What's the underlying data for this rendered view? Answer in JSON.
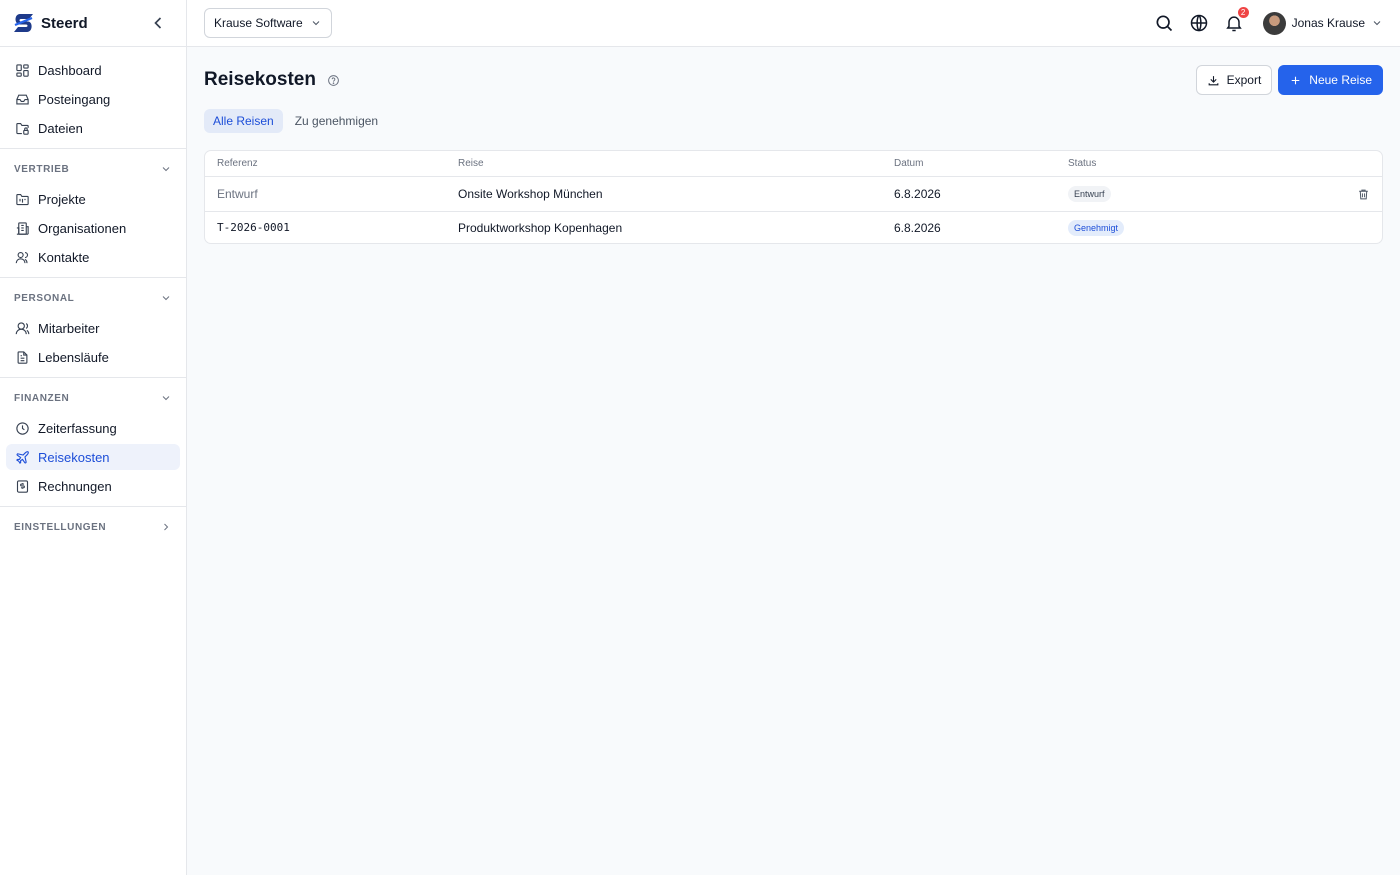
{
  "brand": {
    "name": "Steerd"
  },
  "sidebar": {
    "main_items": [
      {
        "label": "Dashboard",
        "icon": "dashboard-icon"
      },
      {
        "label": "Posteingang",
        "icon": "inbox-icon"
      },
      {
        "label": "Dateien",
        "icon": "folder-lock-icon"
      }
    ],
    "sections": [
      {
        "title": "VERTRIEB",
        "items": [
          {
            "label": "Projekte",
            "icon": "folder-kanban-icon"
          },
          {
            "label": "Organisationen",
            "icon": "building-icon"
          },
          {
            "label": "Kontakte",
            "icon": "users-icon"
          }
        ]
      },
      {
        "title": "PERSONAL",
        "items": [
          {
            "label": "Mitarbeiter",
            "icon": "user-icon"
          },
          {
            "label": "Lebensläufe",
            "icon": "file-text-icon"
          }
        ]
      },
      {
        "title": "FINANZEN",
        "items": [
          {
            "label": "Zeiterfassung",
            "icon": "clock-icon"
          },
          {
            "label": "Reisekosten",
            "icon": "plane-icon",
            "active": true
          },
          {
            "label": "Rechnungen",
            "icon": "receipt-icon"
          }
        ]
      },
      {
        "title": "EINSTELLUNGEN",
        "items": []
      }
    ]
  },
  "topbar": {
    "org": "Krause Software",
    "notifications_count": "2",
    "user_name": "Jonas Krause"
  },
  "page": {
    "title": "Reisekosten",
    "export_label": "Export",
    "new_label": "Neue Reise",
    "tabs": [
      "Alle Reisen",
      "Zu genehmigen"
    ],
    "columns": [
      "Referenz",
      "Reise",
      "Datum",
      "Status"
    ],
    "rows": [
      {
        "ref": "Entwurf",
        "trip": "Onsite Workshop München",
        "date": "6.8.2026",
        "status": "Entwurf"
      },
      {
        "ref": "T-2026-0001",
        "trip": "Produktworkshop Kopenhagen",
        "date": "6.8.2026",
        "status": "Genehmigt"
      }
    ]
  },
  "colors": {
    "accent": "#2563eb",
    "active_bg": "#eef2fb",
    "danger": "#ef4444"
  }
}
